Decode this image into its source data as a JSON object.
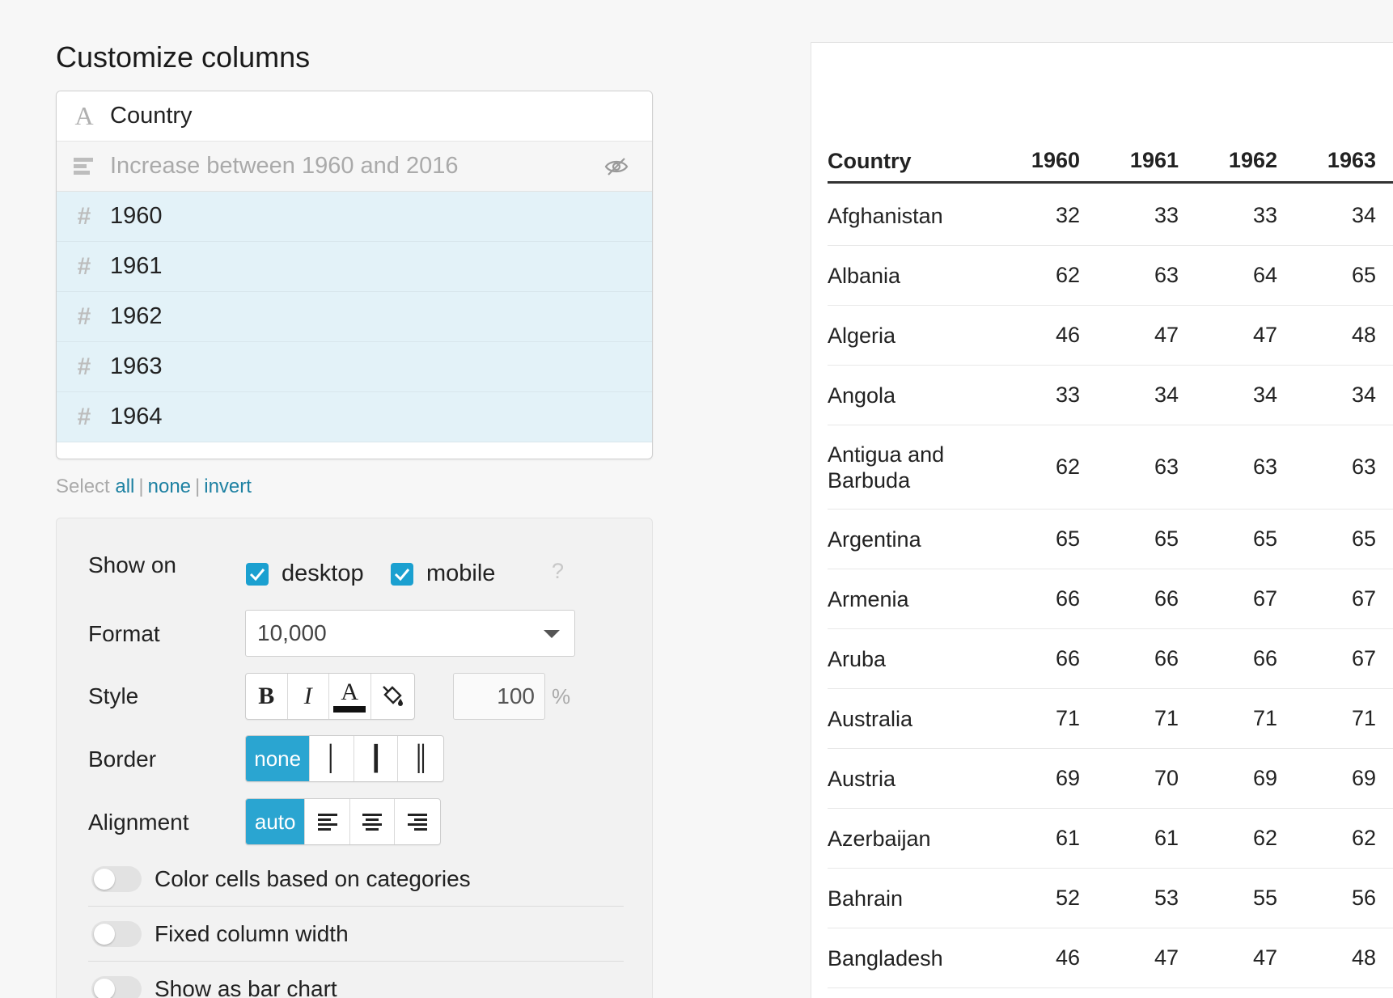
{
  "page_title": "Customize columns",
  "columns": [
    {
      "icon": "text-type-icon",
      "glyph": "A",
      "label": "Country",
      "state": "plain"
    },
    {
      "icon": "bar-chart-type-icon",
      "glyph": "",
      "label": "Increase between 1960 and 2016",
      "state": "hidden"
    },
    {
      "icon": "number-type-icon",
      "glyph": "#",
      "label": "1960",
      "state": "selected"
    },
    {
      "icon": "number-type-icon",
      "glyph": "#",
      "label": "1961",
      "state": "selected"
    },
    {
      "icon": "number-type-icon",
      "glyph": "#",
      "label": "1962",
      "state": "selected"
    },
    {
      "icon": "number-type-icon",
      "glyph": "#",
      "label": "1963",
      "state": "selected"
    },
    {
      "icon": "number-type-icon",
      "glyph": "#",
      "label": "1964",
      "state": "selected"
    }
  ],
  "select": {
    "prefix": "Select",
    "all": "all",
    "none": "none",
    "invert": "invert",
    "separator": "|"
  },
  "settings": {
    "show_on": {
      "label": "Show on",
      "desktop": "desktop",
      "mobile": "mobile",
      "desktop_checked": true,
      "mobile_checked": true,
      "help": "?"
    },
    "format": {
      "label": "Format",
      "value": "10,000"
    },
    "style": {
      "label": "Style",
      "bold": "B",
      "italic": "I",
      "text_color": "A",
      "text_color_swatch": "#111111",
      "width_value": "100",
      "unit": "%"
    },
    "border": {
      "label": "Border",
      "options": [
        "none",
        "│",
        "┃",
        "║"
      ],
      "active": "none"
    },
    "alignment": {
      "label": "Alignment",
      "options": [
        "auto",
        "align-left",
        "align-center",
        "align-right"
      ],
      "active": "auto"
    },
    "toggles": [
      {
        "label": "Color cells based on categories",
        "on": false
      },
      {
        "label": "Fixed column width",
        "on": false
      },
      {
        "label": "Show as bar chart",
        "on": false
      }
    ]
  },
  "table": {
    "headers": [
      "Country",
      "1960",
      "1961",
      "1962",
      "1963"
    ],
    "rows": [
      [
        "Afghanistan",
        "32",
        "33",
        "33",
        "34"
      ],
      [
        "Albania",
        "62",
        "63",
        "64",
        "65"
      ],
      [
        "Algeria",
        "46",
        "47",
        "47",
        "48"
      ],
      [
        "Angola",
        "33",
        "34",
        "34",
        "34"
      ],
      [
        "Antigua and Barbuda",
        "62",
        "63",
        "63",
        "63"
      ],
      [
        "Argentina",
        "65",
        "65",
        "65",
        "65"
      ],
      [
        "Armenia",
        "66",
        "66",
        "67",
        "67"
      ],
      [
        "Aruba",
        "66",
        "66",
        "66",
        "67"
      ],
      [
        "Australia",
        "71",
        "71",
        "71",
        "71"
      ],
      [
        "Austria",
        "69",
        "70",
        "69",
        "69"
      ],
      [
        "Azerbaijan",
        "61",
        "61",
        "62",
        "62"
      ],
      [
        "Bahrain",
        "52",
        "53",
        "55",
        "56"
      ],
      [
        "Bangladesh",
        "46",
        "47",
        "47",
        "48"
      ]
    ]
  },
  "colors": {
    "accent": "#2aa5d1",
    "link": "#1d81a2",
    "selected_row": "#e3f2f8"
  }
}
